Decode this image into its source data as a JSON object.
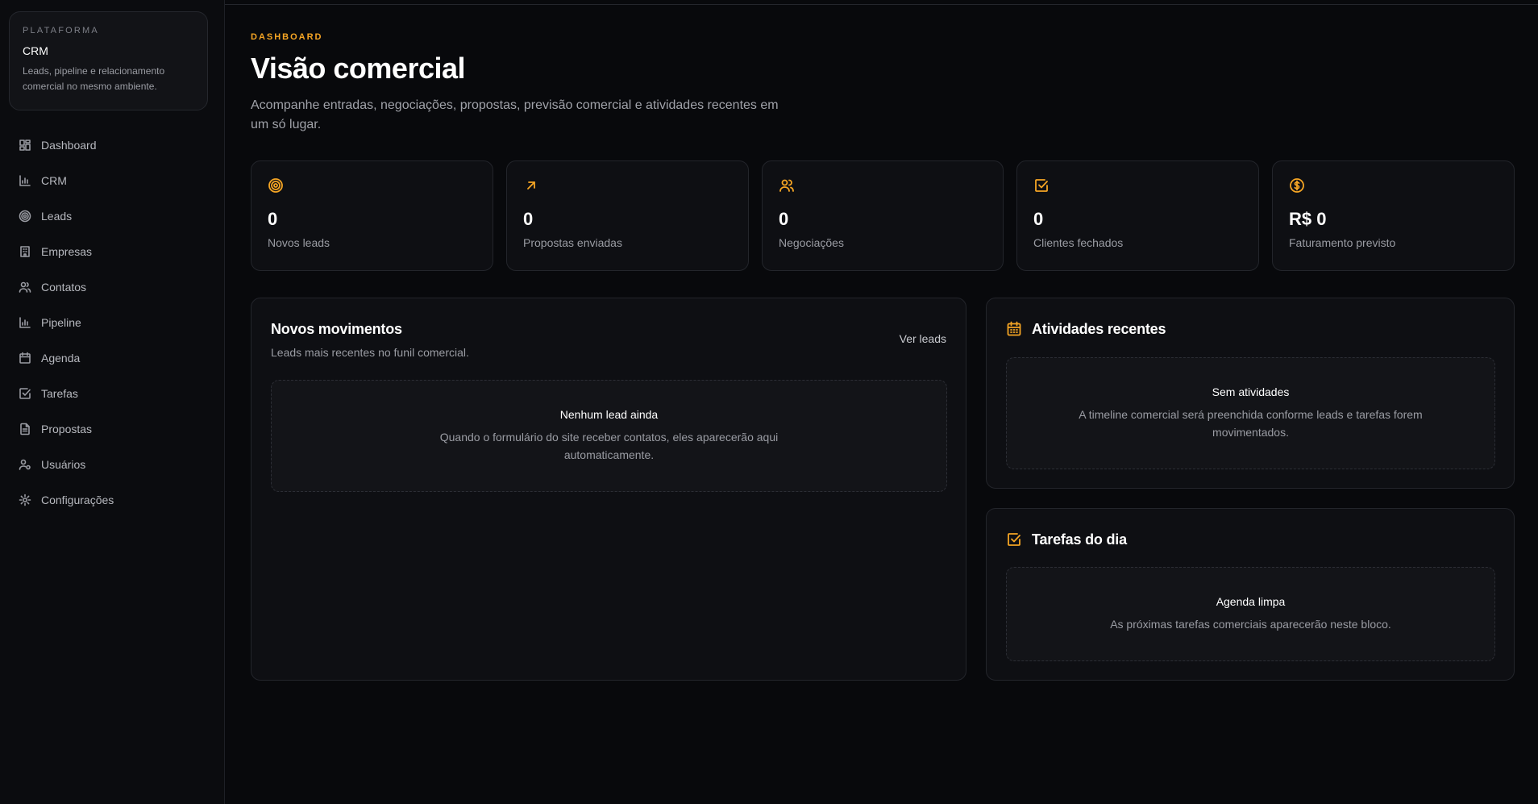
{
  "brand": {
    "eyebrow": "PLATAFORMA",
    "name": "CRM",
    "description": "Leads, pipeline e relacionamento comercial no mesmo ambiente."
  },
  "sidebar": {
    "items": [
      {
        "label": "Dashboard",
        "icon": "dashboard-icon"
      },
      {
        "label": "CRM",
        "icon": "bar-chart-icon"
      },
      {
        "label": "Leads",
        "icon": "target-icon"
      },
      {
        "label": "Empresas",
        "icon": "building-icon"
      },
      {
        "label": "Contatos",
        "icon": "users-icon"
      },
      {
        "label": "Pipeline",
        "icon": "bar-chart-icon"
      },
      {
        "label": "Agenda",
        "icon": "calendar-icon"
      },
      {
        "label": "Tarefas",
        "icon": "check-square-icon"
      },
      {
        "label": "Propostas",
        "icon": "file-text-icon"
      },
      {
        "label": "Usuários",
        "icon": "user-cog-icon"
      },
      {
        "label": "Configurações",
        "icon": "gear-icon"
      }
    ]
  },
  "header": {
    "eyebrow": "DASHBOARD",
    "title": "Visão comercial",
    "subtitle": "Acompanhe entradas, negociações, propostas, previsão comercial e atividades recentes em um só lugar."
  },
  "stats": [
    {
      "value": "0",
      "label": "Novos leads",
      "icon": "target-icon"
    },
    {
      "value": "0",
      "label": "Propostas enviadas",
      "icon": "arrow-up-right-icon"
    },
    {
      "value": "0",
      "label": "Negociações",
      "icon": "users-icon"
    },
    {
      "value": "0",
      "label": "Clientes fechados",
      "icon": "check-square-icon"
    },
    {
      "value": "R$ 0",
      "label": "Faturamento previsto",
      "icon": "dollar-circle-icon"
    }
  ],
  "movements": {
    "title": "Novos movimentos",
    "subtitle": "Leads mais recentes no funil comercial.",
    "link": "Ver leads",
    "empty_title": "Nenhum lead ainda",
    "empty_desc": "Quando o formulário do site receber contatos, eles aparecerão aqui automaticamente."
  },
  "activities": {
    "title": "Atividades recentes",
    "icon": "calendar-icon",
    "empty_title": "Sem atividades",
    "empty_desc": "A timeline comercial será preenchida conforme leads e tarefas forem movimentados."
  },
  "tasks": {
    "title": "Tarefas do dia",
    "icon": "check-square-icon",
    "empty_title": "Agenda limpa",
    "empty_desc": "As próximas tarefas comerciais aparecerão neste bloco."
  },
  "colors": {
    "accent": "#f5a524",
    "background": "#08090c",
    "card": "#0e0f13"
  }
}
